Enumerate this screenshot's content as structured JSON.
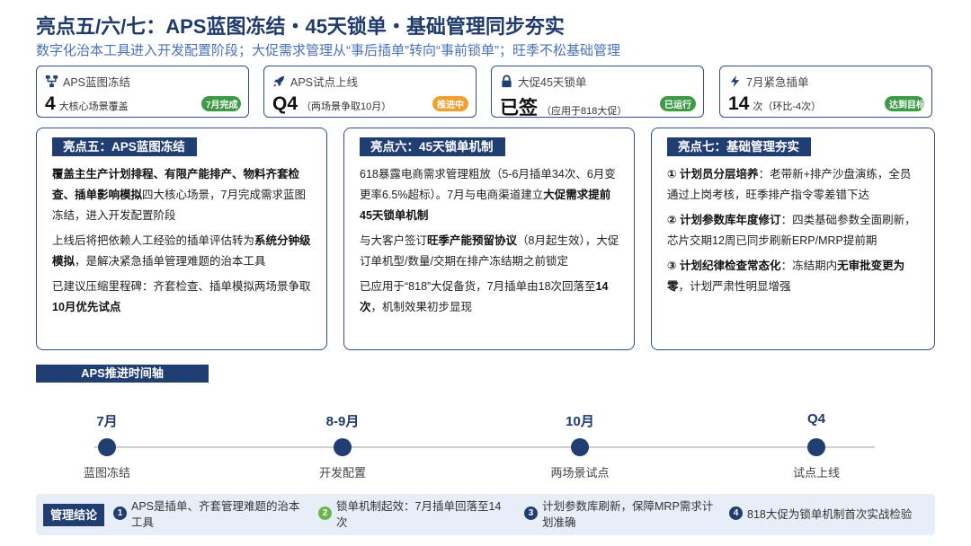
{
  "title": "亮点五/六/七：APS蓝图冻结・45天锁单・基础管理同步夯实",
  "subtitle": "数字化治本工具进入开发配置阶段；大促需求管理从“事后插单”转向“事前锁单”；旺季不松基础管理",
  "kpis": [
    {
      "icon": "flowchart-icon",
      "label": "APS蓝图冻结",
      "value": "4",
      "unit": "大核心场景覆盖",
      "badge": "7月完成",
      "badge_color": "#3d9a45"
    },
    {
      "icon": "rocket-icon",
      "label": "APS试点上线",
      "value": "Q4",
      "unit": "（两场景争取10月）",
      "badge": "推进中",
      "badge_color": "#f0a030"
    },
    {
      "icon": "lock-icon",
      "label": "大促45天锁单",
      "value": "已签",
      "unit": "（应用于818大促）",
      "badge": "已运行",
      "badge_color": "#3d9a45"
    },
    {
      "icon": "lightning-icon",
      "label": "7月紧急插单",
      "value": "14",
      "unit": "次（环比-4次）",
      "badge": "达到目标",
      "badge_color": "#3d9a45"
    }
  ],
  "cards": {
    "c5": {
      "head": "亮点五：APS蓝图冻结",
      "p1_b": "覆盖主生产计划排程、有限产能排产、物料齐套检查、插单影响模拟",
      "p1_t": "四大核心场景，7月完成需求蓝图冻结，进入开发配置阶段",
      "p2_t1": "上线后将把依赖人工经验的插单评估转为",
      "p2_b": "系统分钟级模拟",
      "p2_t2": "，是解决紧急插单管理难题的治本工具",
      "p3_t1": "已建议压缩里程碑：齐套检查、插单模拟两场景争取",
      "p3_b": "10月优先试点"
    },
    "c6": {
      "head": "亮点六：45天锁单机制",
      "p1_t1": "618暴露电商需求管理粗放（5-6月插单34次、6月变更率6.5%超标）。7月与电商渠道建立",
      "p1_b": "大促需求提前45天锁单机制",
      "p2_t1": "与大客户签订",
      "p2_b": "旺季产能预留协议",
      "p2_t2": "（8月起生效），大促订单机型/数量/交期在排产冻结期之前锁定",
      "p3_t1": "已应用于“818”大促备货，7月插单由18次回落至",
      "p3_b": "14次",
      "p3_t2": "，机制效果初步显现"
    },
    "c7": {
      "head": "亮点七：基础管理夯实",
      "p1_b": "① 计划员分层培养",
      "p1_t": "：老带新+排产沙盘演练，全员通过上岗考核，旺季排产指令零差错下达",
      "p2_b": "② 计划参数库年度修订",
      "p2_t": "：四类基础参数全面刷新，芯片交期12周已同步刷新ERP/MRP提前期",
      "p3_b": "③ 计划纪律检查常态化",
      "p3_t1": "：冻结期内",
      "p3_b2": "无审批变更为零",
      "p3_t2": "，计划严肃性明显增强"
    }
  },
  "timeline": {
    "title": "APS推进时间轴",
    "nodes": [
      {
        "label": "7月",
        "desc": "蓝图冻结"
      },
      {
        "label": "8-9月",
        "desc": "开发配置"
      },
      {
        "label": "10月",
        "desc": "两场景试点"
      },
      {
        "label": "Q4",
        "desc": "试点上线"
      }
    ]
  },
  "conclusion": {
    "tag": "管理结论",
    "items": [
      {
        "num": "1",
        "color": "#213e72",
        "text": "APS是插单、齐套管理难题的治本工具"
      },
      {
        "num": "2",
        "color": "#6bb54a",
        "text": "锁单机制起效：7月插单回落至14次"
      },
      {
        "num": "3",
        "color": "#213e72",
        "text": "计划参数库刷新，保障MRP需求计划准确"
      },
      {
        "num": "4",
        "color": "#213e72",
        "text": "818大促为锁单机制首次实战检验"
      }
    ]
  }
}
